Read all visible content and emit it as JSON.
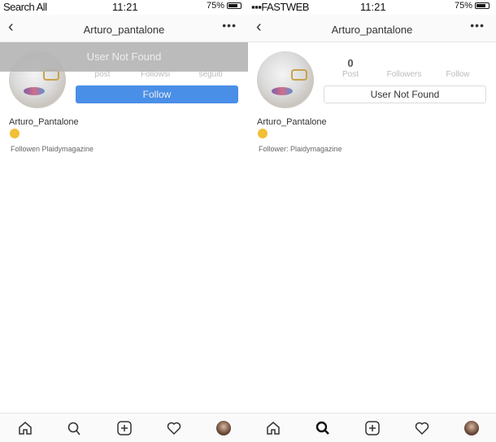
{
  "left": {
    "status": {
      "carrier": "Search All",
      "time": "11:21",
      "battery": "75%"
    },
    "nav": {
      "back_icon": "chevron-left-icon",
      "title": "Arturo_pantalone",
      "more_icon": "more-horizontal-icon"
    },
    "overlay_message": "User Not Found",
    "stats": {
      "labels": [
        "post",
        "Followsi",
        "seguiti"
      ]
    },
    "follow_button": "Follow",
    "profile": {
      "name": "Arturo_Pantalone",
      "emoji": "😀",
      "followed_by": "Followen Plaidymagazine"
    },
    "accent_color": "#4a8fe7"
  },
  "right": {
    "status": {
      "carrier": "FASTWEB",
      "time": "11:21",
      "battery": "75%"
    },
    "nav": {
      "back_icon": "chevron-left-icon",
      "title": "Arturo_pantalone",
      "more_icon": "more-horizontal-icon"
    },
    "stats": {
      "post_count": "0",
      "labels": [
        "Post",
        "Followers",
        "Follow"
      ]
    },
    "status_button": "User Not Found",
    "profile": {
      "name": "Arturo_Pantalone",
      "emoji": "😀",
      "followed_by": "Follower: Plaidymagazine"
    }
  },
  "tabbar_icons": [
    "home-icon",
    "search-icon",
    "add-icon",
    "heart-icon",
    "profile-avatar"
  ]
}
